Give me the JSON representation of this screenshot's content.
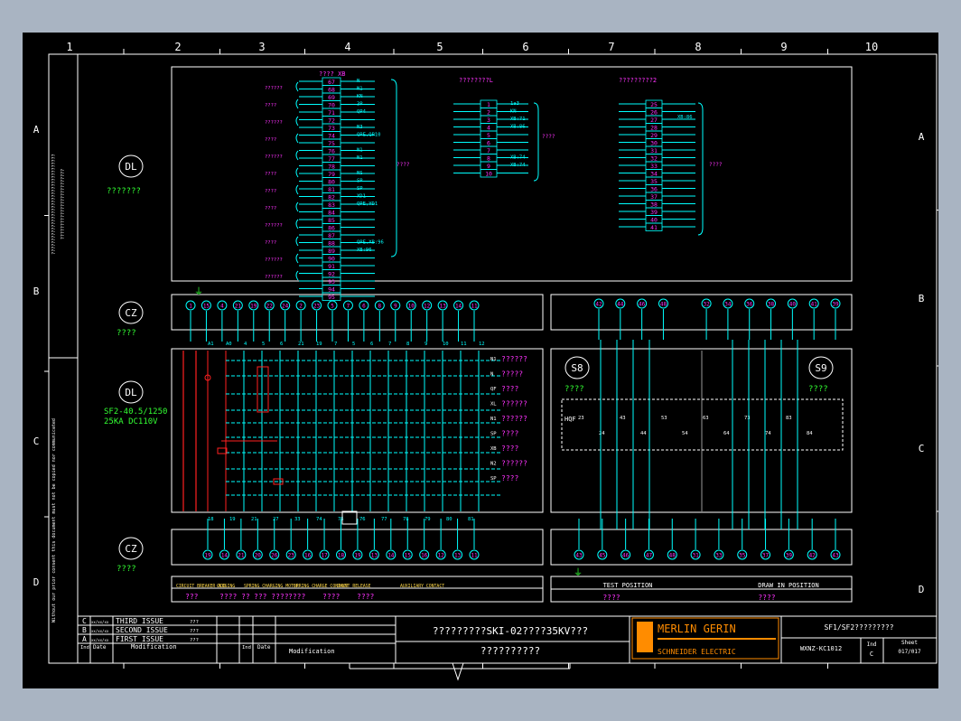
{
  "sheet": {
    "col_numbers": [
      "1",
      "2",
      "3",
      "4",
      "5",
      "6",
      "7",
      "8",
      "9",
      "10"
    ],
    "row_letters": [
      "A",
      "B",
      "C",
      "D"
    ]
  },
  "panels": {
    "dl_top": {
      "tag": "DL",
      "label": "???????"
    },
    "cz_top": {
      "tag": "CZ",
      "label": "????"
    },
    "dl_mid": {
      "tag": "DL",
      "label1": "SF2-40.5/1250",
      "label2": "25KA DC110V"
    },
    "cz_bot": {
      "tag": "CZ",
      "label": "????"
    },
    "s8": {
      "tag": "S8",
      "label": "????"
    },
    "s9": {
      "tag": "S9",
      "label": "????"
    }
  },
  "terminal_blocks": {
    "xb_title": "????  XB",
    "xb_left_labels": [
      "??????",
      "????",
      "??????",
      "????",
      "??????",
      "????",
      "????",
      "????",
      "??????",
      "????",
      "??????",
      "??????"
    ],
    "xb_nums": [
      "67",
      "68",
      "69",
      "70",
      "71",
      "72",
      "73",
      "74",
      "75",
      "76",
      "77",
      "78",
      "79",
      "80",
      "81",
      "82",
      "83",
      "84",
      "85",
      "86",
      "87",
      "88",
      "89",
      "90",
      "91",
      "92",
      "93",
      "94",
      "95"
    ],
    "xb_right_labels": [
      "N",
      "N1",
      "KN",
      "3P",
      "QP4",
      "",
      "N3",
      "QPE,QP10",
      "",
      "N1",
      "N1",
      "",
      "NS",
      "SP",
      "SP",
      "XD1",
      "QPE,YD1",
      "",
      "",
      "",
      "",
      "QPE,XB:96",
      "XB:96"
    ],
    "xb_side": "????",
    "xl_title": "????????L",
    "xl_nums": [
      "1",
      "2",
      "3",
      "4",
      "5",
      "6",
      "7",
      "8",
      "9",
      "10"
    ],
    "xl_right_labels": [
      "1a3",
      "KN",
      "XB:71",
      "XB:86",
      "",
      "",
      "",
      "XB:74",
      "XB:74",
      ""
    ],
    "xl_side": "????",
    "x2_title": "?????????2",
    "x2_nums": [
      "25",
      "26",
      "27",
      "28",
      "29",
      "30",
      "31",
      "32",
      "33",
      "34",
      "35",
      "36",
      "37",
      "38",
      "39",
      "40",
      "41"
    ],
    "x2_right_labels": [
      "XB:86"
    ],
    "x2_side": "????"
  },
  "plug_top_left": [
    "1",
    "15",
    "4",
    "21",
    "19",
    "22",
    "24",
    "2",
    "23",
    "5",
    "7",
    "6",
    "8",
    "9",
    "10",
    "12",
    "13",
    "14",
    "11"
  ],
  "plug_top_right": [
    "42",
    "44",
    "46",
    "48",
    "",
    "32",
    "34",
    "36",
    "38",
    "40",
    "41",
    "39"
  ],
  "plug_bot_left": [
    "19",
    "14",
    "21",
    "20",
    "26",
    "23",
    "16",
    "17",
    "18",
    "19",
    "13",
    "14",
    "15",
    "16",
    "12",
    "13",
    "11"
  ],
  "plug_bot_right": [
    "43",
    "45",
    "46",
    "47",
    "48",
    "31",
    "33",
    "35",
    "37",
    "39",
    "42",
    "43"
  ],
  "wire_tops": [
    "A1",
    "A0",
    "4",
    "5",
    "6",
    "21",
    "19",
    "7",
    "5",
    "6",
    "7",
    "8",
    "9",
    "10",
    "11",
    "12"
  ],
  "wire_bots": [
    "18",
    "19",
    "21",
    "27",
    "33",
    "74",
    "75",
    "76",
    "77",
    "78",
    "79",
    "80",
    "81"
  ],
  "schematic_labels": {
    "right_tags": [
      "N1",
      "N",
      "QF",
      "XL",
      "N1",
      "SP",
      "XB",
      "N2",
      "SP"
    ],
    "right_desc": [
      "??????",
      "?????",
      "????",
      "??????",
      "??????",
      "????",
      "????",
      "??????",
      "????"
    ]
  },
  "switch_panel": {
    "hqf": "HQF",
    "contacts": [
      "23",
      "24",
      "43",
      "44",
      "53",
      "54",
      "63",
      "64",
      "73",
      "74",
      "83",
      "84"
    ]
  },
  "bottom_strip": {
    "left_headers": [
      "CIRCUIT BREAKER ADD",
      "CLOSING",
      "SPRING CHARGING MOTOR",
      "SPRING CHARGE CONTACT",
      "SHUNT RELEASE",
      "AUXILIARY CONTACT"
    ],
    "left_values": [
      "???",
      "???? ??",
      "??? ????",
      "????",
      "????",
      "????"
    ],
    "right_headers": [
      "TEST POSITION",
      "DRAW IN POSITION"
    ],
    "right_values": [
      "????",
      "????"
    ]
  },
  "title_block": {
    "rev_marks": [
      "C",
      "B",
      "A"
    ],
    "rev_dates": [
      "xx/xx/xx",
      "xx/xx/xx",
      "xx/xx/xx"
    ],
    "rev_text": [
      "THIRD ISSUE",
      "SECOND ISSUE",
      "FIRST ISSUE"
    ],
    "rev_by": [
      "???",
      "???",
      "???"
    ],
    "hdr_ind": "Ind",
    "hdr_date": "Date",
    "hdr_mod": "Modification",
    "hdr_ind2": "Ind",
    "hdr_date2": "Date",
    "hdr_mod2": "Modification",
    "title_line1": "?????????SKI-02????35KV???",
    "title_line2": "??????????",
    "brand": "MERLIN GERIN",
    "brand_sub": "SCHNEIDER ELECTRIC",
    "drawing_title": "SF1/SF2?????????",
    "drawing_no": "WXNZ-KC1012",
    "ind_label": "Ind",
    "ind_value": "C",
    "sheet_label": "Sheet",
    "sheet_value": "017/017"
  },
  "side_notes": [
    "?????????????????????????????????????",
    "??????????????????????????",
    "Without our prior consent this document must not be copied nor communicated"
  ],
  "colors": {
    "frame": "#ffffff",
    "cyan": "#00ffff",
    "magenta": "#ff33ff",
    "green": "#33ff33",
    "red": "#ff2020",
    "yellow": "#ffff00",
    "orange": "#ff8c00"
  }
}
